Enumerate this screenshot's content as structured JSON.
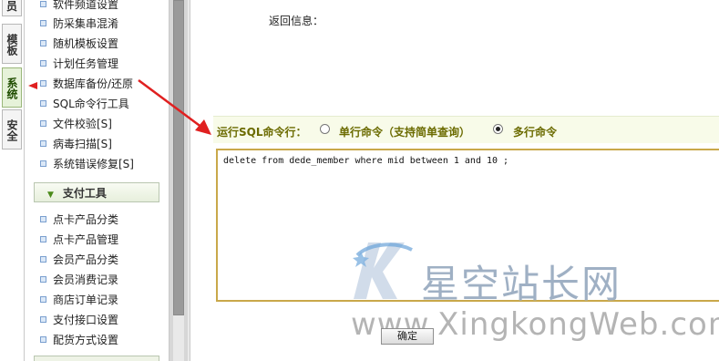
{
  "vertical_tabs": [
    {
      "label": "员"
    },
    {
      "label": "模板"
    },
    {
      "label": "系统"
    },
    {
      "label": "安全"
    }
  ],
  "sidebar": {
    "items_top": [
      {
        "label": "软件频道设置"
      },
      {
        "label": "防采集串混淆"
      },
      {
        "label": "随机模板设置"
      },
      {
        "label": "计划任务管理"
      },
      {
        "label": "数据库备份/还原"
      },
      {
        "label": "SQL命令行工具"
      },
      {
        "label": "文件校验[S]"
      },
      {
        "label": "病毒扫描[S]"
      },
      {
        "label": "系统错误修复[S]"
      }
    ],
    "section_title": "支付工具",
    "items_pay": [
      {
        "label": "点卡产品分类"
      },
      {
        "label": "点卡产品管理"
      },
      {
        "label": "会员产品分类"
      },
      {
        "label": "会员消费记录"
      },
      {
        "label": "商店订单记录"
      },
      {
        "label": "支付接口设置"
      },
      {
        "label": "配货方式设置"
      }
    ]
  },
  "main": {
    "return_info_label": "返回信息：",
    "sql_bar_label": "运行SQL命令行：",
    "radio_single_label": "单行命令（支持简单查询）",
    "radio_multi_label": "多行命令",
    "selected_mode": "multi",
    "sql_text": "delete from dede_member where mid between 1 and 10 ;",
    "ok_button_label": "确定"
  },
  "watermark": {
    "brand": "星空站长网",
    "url": "www.XingkongWeb.com"
  },
  "colors": {
    "annotation_red": "#e02020",
    "textarea_border": "#c9a84a",
    "sql_bar_text": "#6b6b00"
  }
}
